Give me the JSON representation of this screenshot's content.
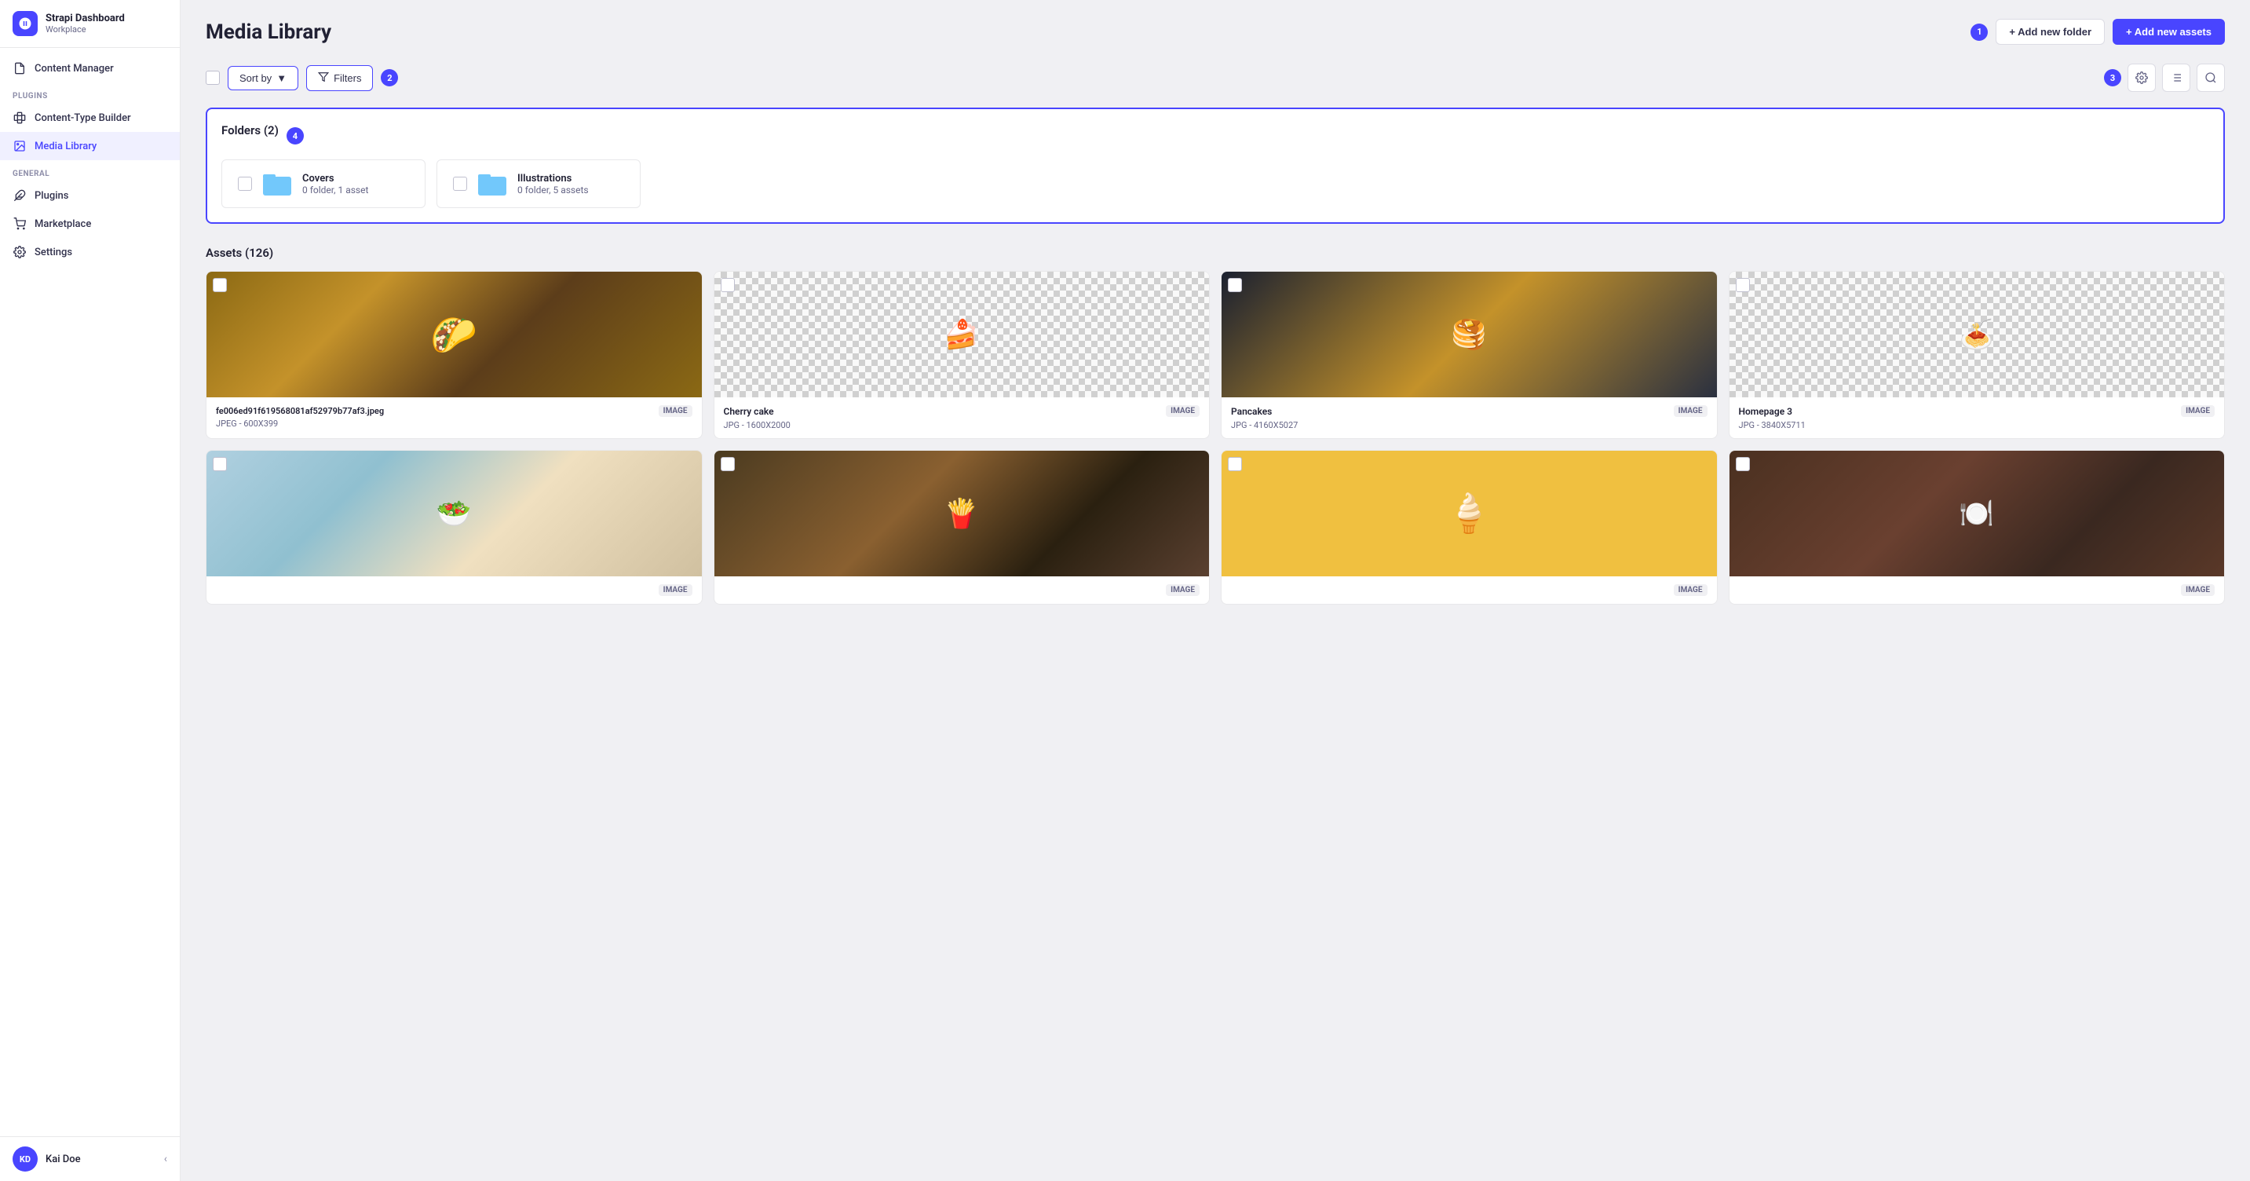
{
  "sidebar": {
    "app_name": "Strapi Dashboard",
    "app_subtitle": "Workplace",
    "nav_items": [
      {
        "label": "Content Manager",
        "icon": "file-icon",
        "active": false
      },
      {
        "label": "Content-Type Builder",
        "icon": "puzzle-icon",
        "section": "PLUGINS",
        "active": false
      },
      {
        "label": "Media Library",
        "icon": "photos-icon",
        "active": true
      },
      {
        "label": "Plugins",
        "icon": "puzzle-icon",
        "section": "GENERAL",
        "active": false
      },
      {
        "label": "Marketplace",
        "icon": "cart-icon",
        "active": false
      },
      {
        "label": "Settings",
        "icon": "gear-icon",
        "active": false
      }
    ],
    "user": {
      "initials": "KD",
      "name": "Kai Doe"
    },
    "collapse_label": "<"
  },
  "header": {
    "title": "Media Library",
    "badge_number": "1",
    "add_folder_label": "+ Add new folder",
    "add_assets_label": "+ Add new assets"
  },
  "toolbar": {
    "sort_by_label": "Sort by",
    "filters_label": "Filters",
    "badge_number": "2",
    "badge_number_right": "3"
  },
  "folders": {
    "title": "Folders (2)",
    "badge_number": "4",
    "items": [
      {
        "name": "Covers",
        "meta": "0 folder, 1 asset"
      },
      {
        "name": "Illustrations",
        "meta": "0 folder, 5 assets"
      }
    ]
  },
  "assets": {
    "title": "Assets (126)",
    "items": [
      {
        "name": "fe006ed91f619568081af52979b77af3.jpeg",
        "format": "JPEG - 600X399",
        "type": "IMAGE",
        "img_class": "img-sandwich"
      },
      {
        "name": "Cherry cake",
        "format": "JPG - 1600X2000",
        "type": "IMAGE",
        "img_class": "img-cake",
        "checkered": true
      },
      {
        "name": "Pancakes",
        "format": "JPG - 4160X5027",
        "type": "IMAGE",
        "img_class": "img-pancakes",
        "checkered": true
      },
      {
        "name": "Homepage 3",
        "format": "JPG - 3840X5711",
        "type": "IMAGE",
        "img_class": "img-pasta",
        "checkered": true
      },
      {
        "name": "",
        "format": "",
        "type": "IMAGE",
        "img_class": "img-bowl"
      },
      {
        "name": "",
        "format": "",
        "type": "IMAGE",
        "img_class": "img-street"
      },
      {
        "name": "",
        "format": "",
        "type": "IMAGE",
        "img_class": "img-icecream"
      },
      {
        "name": "",
        "format": "",
        "type": "IMAGE",
        "img_class": "img-restaurant"
      }
    ]
  }
}
